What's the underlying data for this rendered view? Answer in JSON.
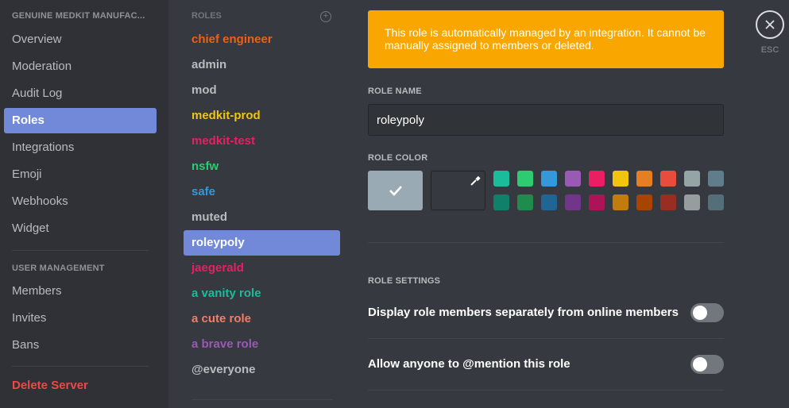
{
  "sidebar": {
    "header": "GENUINE MEDKIT MANUFAC...",
    "items": [
      {
        "label": "Overview"
      },
      {
        "label": "Moderation"
      },
      {
        "label": "Audit Log"
      },
      {
        "label": "Roles"
      },
      {
        "label": "Integrations"
      },
      {
        "label": "Emoji"
      },
      {
        "label": "Webhooks"
      },
      {
        "label": "Widget"
      }
    ],
    "user_management_header": "USER MANAGEMENT",
    "user_items": [
      {
        "label": "Members"
      },
      {
        "label": "Invites"
      },
      {
        "label": "Bans"
      }
    ],
    "delete_label": "Delete Server"
  },
  "roles": {
    "header": "ROLES",
    "add_icon": "plus-circle-icon",
    "items": [
      {
        "label": "chief engineer",
        "color": "#f25f14"
      },
      {
        "label": "admin",
        "color": "#b9bbbe"
      },
      {
        "label": "mod",
        "color": "#b9bbbe"
      },
      {
        "label": "medkit-prod",
        "color": "#f1c40f"
      },
      {
        "label": "medkit-test",
        "color": "#e91e63"
      },
      {
        "label": "nsfw",
        "color": "#2ecc71"
      },
      {
        "label": "safe",
        "color": "#3498db"
      },
      {
        "label": "muted",
        "color": "#b9bbbe"
      },
      {
        "label": "roleypoly",
        "color": "#ffffff"
      },
      {
        "label": "jaegerald",
        "color": "#e91e63"
      },
      {
        "label": "a vanity role",
        "color": "#1abc9c"
      },
      {
        "label": "a cute role",
        "color": "#f47b67"
      },
      {
        "label": "a brave role",
        "color": "#9b59b6"
      },
      {
        "label": "@everyone",
        "color": "#b9bbbe"
      }
    ],
    "selected": "roleypoly"
  },
  "main": {
    "notice": "This role is automatically managed by an integration. It cannot be manually assigned to members or deleted.",
    "role_name_label": "ROLE NAME",
    "role_name_value": "roleypoly",
    "role_color_label": "ROLE COLOR",
    "selected_color": "#99aab5",
    "check_icon": "checkmark-icon",
    "eyedropper_icon": "eyedropper-icon",
    "swatches_top": [
      "#1abc9c",
      "#2ecc71",
      "#3498db",
      "#9b59b6",
      "#e91e63",
      "#f1c40f",
      "#e67e22",
      "#e74c3c",
      "#95a5a6",
      "#607d8b"
    ],
    "swatches_bottom": [
      "#11806a",
      "#1f8b4c",
      "#206694",
      "#71368a",
      "#ad1457",
      "#c27c0e",
      "#a84300",
      "#992d22",
      "#979c9f",
      "#546e7a"
    ],
    "role_settings_label": "ROLE SETTINGS",
    "settings": [
      {
        "label": "Display role members separately from online members",
        "enabled": false
      },
      {
        "label": "Allow anyone to @mention this role",
        "enabled": false
      }
    ]
  },
  "close": {
    "icon": "close-icon",
    "label": "ESC"
  },
  "colors": {
    "accent": "#7289da",
    "warning": "#f9a600",
    "danger": "#f04747"
  }
}
